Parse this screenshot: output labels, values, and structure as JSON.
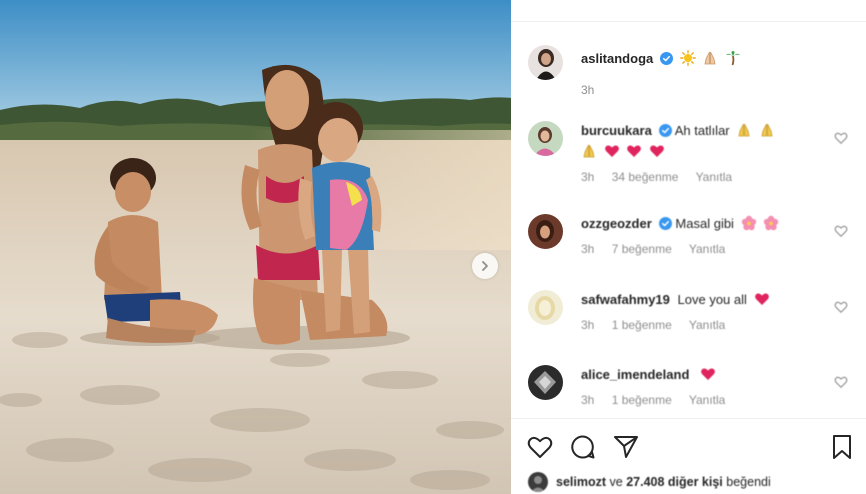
{
  "post": {
    "owner": {
      "username": "aslitandoga",
      "verified": true,
      "caption_emojis": [
        "sun",
        "folded-hands",
        "palm-tree"
      ]
    },
    "caption_time": "3h",
    "carousel_has_next": true
  },
  "comments": [
    {
      "username": "burcuukara",
      "verified": true,
      "text": "Ah tatlılar",
      "emojis_line1": [
        "folded-hands",
        "folded-hands"
      ],
      "emojis_line2": [
        "folded-hands",
        "heart",
        "heart",
        "heart"
      ],
      "time": "3h",
      "likes": "34 beğenme",
      "reply": "Yanıtla"
    },
    {
      "username": "ozzgeozder",
      "verified": true,
      "text": "Masal gibi",
      "emojis_line1": [
        "cherry-blossom",
        "cherry-blossom"
      ],
      "time": "3h",
      "likes": "7 beğenme",
      "reply": "Yanıtla"
    },
    {
      "username": "safwafahmy19",
      "verified": false,
      "text": "Love you all",
      "emojis_line1": [
        "heart"
      ],
      "time": "3h",
      "likes": "1 beğenme",
      "reply": "Yanıtla"
    },
    {
      "username": "alice_imendeland",
      "verified": false,
      "text": "",
      "emojis_line1": [
        "heart"
      ],
      "time": "3h",
      "likes": "1 beğenme",
      "reply": "Yanıtla"
    }
  ],
  "likes_summary": {
    "first_liker": "selimozt",
    "connector": "ve",
    "others": "27.408 diğer kişi",
    "suffix": "beğendi"
  },
  "action_icons": [
    "heart-outline-icon",
    "comment-icon",
    "share-icon",
    "bookmark-icon"
  ],
  "colors": {
    "text": "#262626",
    "secondary": "#8e8e8e",
    "verified": "#3897f0",
    "heart": "#e0245e",
    "divider": "#efefef"
  }
}
